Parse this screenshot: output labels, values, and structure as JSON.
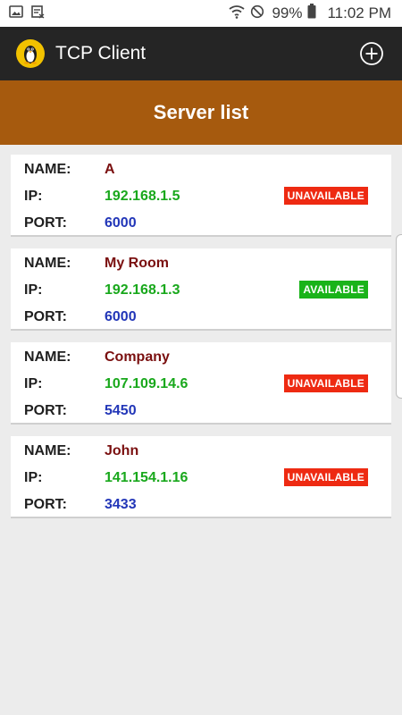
{
  "status_bar": {
    "icons": [
      "image-icon",
      "screenshot-icon",
      "wifi-icon",
      "do-not-disturb-icon",
      "battery-icon"
    ],
    "battery_percent": "99%",
    "time": "11:02 PM"
  },
  "app_bar": {
    "title": "TCP Client",
    "logo_icon": "penguin-icon",
    "action_icon": "add-circle-icon"
  },
  "header": {
    "title": "Server list"
  },
  "labels": {
    "name": "NAME:",
    "ip": "IP:",
    "port": "PORT:"
  },
  "servers": [
    {
      "name": "A",
      "ip": "192.168.1.5",
      "port": "6000",
      "status": "UNAVAILABLE"
    },
    {
      "name": "My Room",
      "ip": "192.168.1.3",
      "port": "6000",
      "status": "AVAILABLE"
    },
    {
      "name": "Company",
      "ip": "107.109.14.6",
      "port": "5450",
      "status": "UNAVAILABLE"
    },
    {
      "name": "John",
      "ip": "141.154.1.16",
      "port": "3433",
      "status": "UNAVAILABLE"
    }
  ],
  "colors": {
    "app_bar": "#252525",
    "header": "#a65a0e",
    "name": "#7a0f0f",
    "ip": "#19a81c",
    "port": "#2236b8",
    "unavailable": "#ee2a12",
    "available": "#19b319"
  }
}
